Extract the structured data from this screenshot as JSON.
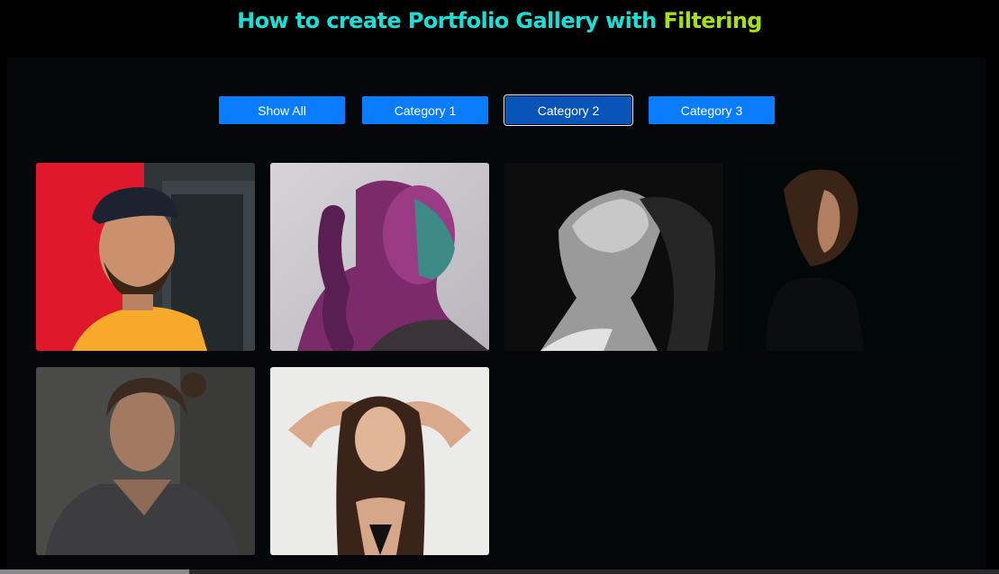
{
  "heading": {
    "part1": "How to create Portfolio Gallery with",
    "part2": "Filtering"
  },
  "filters": [
    {
      "label": "Show All",
      "active": false
    },
    {
      "label": "Category 1",
      "active": false
    },
    {
      "label": "Category 2",
      "active": true
    },
    {
      "label": "Category 3",
      "active": false
    }
  ],
  "gallery": [
    {
      "subject": "man-yellow-shirt-cap-portrait"
    },
    {
      "subject": "woman-pink-neon-profile-portrait"
    },
    {
      "subject": "woman-black-white-portrait"
    },
    {
      "subject": "woman-dark-profile-portrait"
    },
    {
      "subject": "woman-grey-sweater-portrait"
    },
    {
      "subject": "woman-hands-in-hair-portrait"
    }
  ],
  "colors": {
    "heading_main": "#18e0d6",
    "heading_accent": "#a5e012",
    "button": "#0a7cff",
    "button_active": "#0954b8",
    "panel": "#05070a"
  }
}
